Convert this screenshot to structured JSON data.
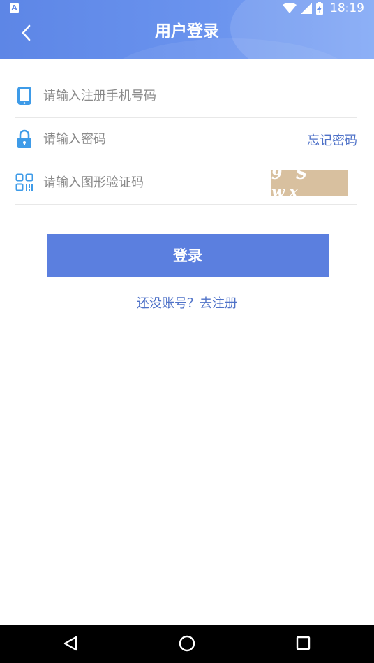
{
  "status_bar": {
    "notification_letter": "A",
    "time": "18:19"
  },
  "header": {
    "title": "用户登录",
    "gradient_start": "#5d86e6",
    "gradient_end": "#7ea5f5"
  },
  "form": {
    "phone": {
      "placeholder": "请输入注册手机号码",
      "value": "",
      "icon": "phone-icon"
    },
    "password": {
      "placeholder": "请输入密码",
      "value": "",
      "icon": "lock-icon",
      "forgot_label": "忘记密码"
    },
    "captcha": {
      "placeholder": "请输入图形验证码",
      "value": "",
      "icon": "qr-code-icon",
      "image_text": "9 S wx"
    }
  },
  "login_button": {
    "label": "登录",
    "color": "#5b7fdf"
  },
  "register_link": {
    "label": "还没账号？去注册"
  },
  "accent_color": "#4f72c8",
  "nav_bar": {
    "buttons": [
      "back-triangle-icon",
      "home-circle-icon",
      "recents-square-icon"
    ]
  }
}
